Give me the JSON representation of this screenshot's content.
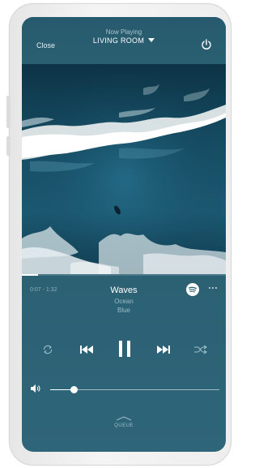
{
  "header": {
    "close_label": "Close",
    "now_playing_label": "Now Playing",
    "room_label": "LIVING ROOM",
    "icons": [
      "chevron-down-icon",
      "power-icon"
    ]
  },
  "track": {
    "time_label": "0:07 - 1:32",
    "title": "Waves",
    "artist": "Ocean",
    "album": "Blue",
    "progress": 0.08,
    "service_icon": "spotify-icon",
    "more_icon": "more-icon"
  },
  "controls": {
    "icons": [
      "repeat-icon",
      "previous-icon",
      "pause-icon",
      "next-icon",
      "shuffle-icon"
    ]
  },
  "volume": {
    "icon": "volume-icon",
    "level": 0.14
  },
  "queue": {
    "label": "QUEUE",
    "icon": "chevron-up-icon"
  },
  "colors": {
    "background": "#2c6174",
    "ocean_dark": "#0d3345",
    "ocean_mid": "#1b5a73",
    "foam": "#f2f4f3",
    "text": "#ffffff",
    "muted_text": "#9dbcc7"
  }
}
